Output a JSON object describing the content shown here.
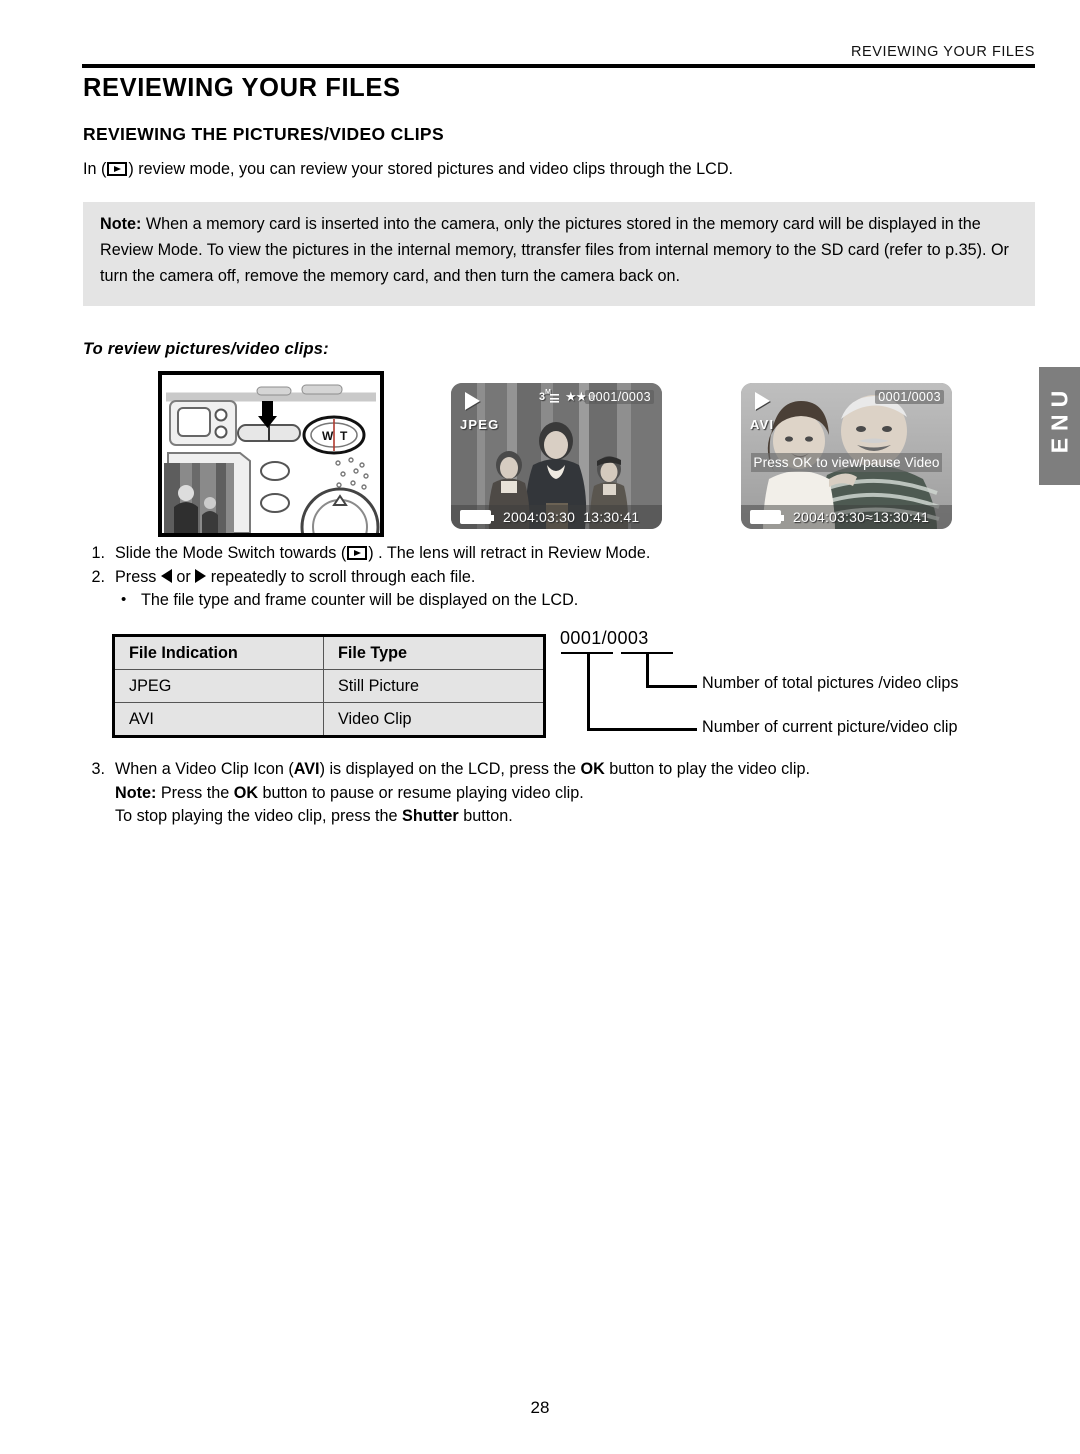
{
  "document": {
    "running_header": "REVIEWING YOUR FILES",
    "page_number": "28",
    "language_tab": "ENU"
  },
  "headings": {
    "title": "REVIEWING YOUR FILES",
    "section": "REVIEWING THE PICTURES/VIDEO CLIPS",
    "procedure": "To review pictures/video clips:"
  },
  "intro": {
    "before_icon": "In (",
    "icon": "play-icon",
    "after_icon": ") review mode, you can review your stored pictures and video clips through the LCD."
  },
  "note_box": {
    "label": "Note:",
    "text": "When a memory card is inserted into the camera, only the pictures stored in the memory card will be displayed in the Review Mode. To view the pictures in the internal memory, ttransfer files from internal memory to the SD card (refer to p.35). Or turn the camera off, remove the memory card, and then turn the camera back on."
  },
  "figures": {
    "camera": {
      "caption_icons": [
        "W",
        "T"
      ],
      "zoom_w": "W",
      "zoom_t": "T"
    },
    "lcd_still": {
      "mode_icon": "play-icon",
      "file_format": "JPEG",
      "resolution": "3",
      "resolution_unit": "M",
      "quality_stars": "★★★",
      "frame_counter": "0001/0003",
      "date": "2004:03:30",
      "time": "13:30:41",
      "battery_icon": "battery-full-icon"
    },
    "lcd_video": {
      "mode_icon": "play-icon",
      "file_format": "AVI",
      "frame_counter": "0001/0003",
      "overlay_message": "Press OK to view/pause Video",
      "date": "2004:03:30",
      "separator": "≈",
      "time": "13:30:41",
      "battery_icon": "battery-full-icon"
    }
  },
  "steps": [
    {
      "number": "1.",
      "before_icon": "Slide the Mode Switch towards (",
      "icon": "play-icon",
      "after_icon": ") . The lens will retract in Review Mode."
    },
    {
      "number": "2.",
      "before_icon": "Press ",
      "icon_left": "arrow-left-icon",
      "between": " or ",
      "icon_right": "arrow-right-icon",
      "after_icon": " repeatedly to scroll through each file."
    }
  ],
  "step2_bullet": {
    "bullet": "•",
    "text": "The file type and frame counter will be displayed on the LCD."
  },
  "file_table": {
    "headers": [
      "File Indication",
      "File Type"
    ],
    "rows": [
      [
        "JPEG",
        "Still Picture"
      ],
      [
        "AVI",
        "Video Clip"
      ]
    ]
  },
  "callout": {
    "value": "0001/0003",
    "label_total": "Number of total pictures /video clips",
    "label_current": "Number of current picture/video clip"
  },
  "step3": {
    "number": "3.",
    "part1": "When a Video Clip Icon (",
    "bold1": "AVI",
    "part2": ") is displayed on the LCD, press the ",
    "bold2": "OK",
    "part3": " button to play the video clip.",
    "note_label": "Note:",
    "note_part1": " Press the ",
    "note_bold": "OK",
    "note_part2": " button to pause or resume playing video clip.",
    "stop_part1": "To stop playing the video clip, press the ",
    "stop_bold": "Shutter",
    "stop_part2": " button."
  }
}
